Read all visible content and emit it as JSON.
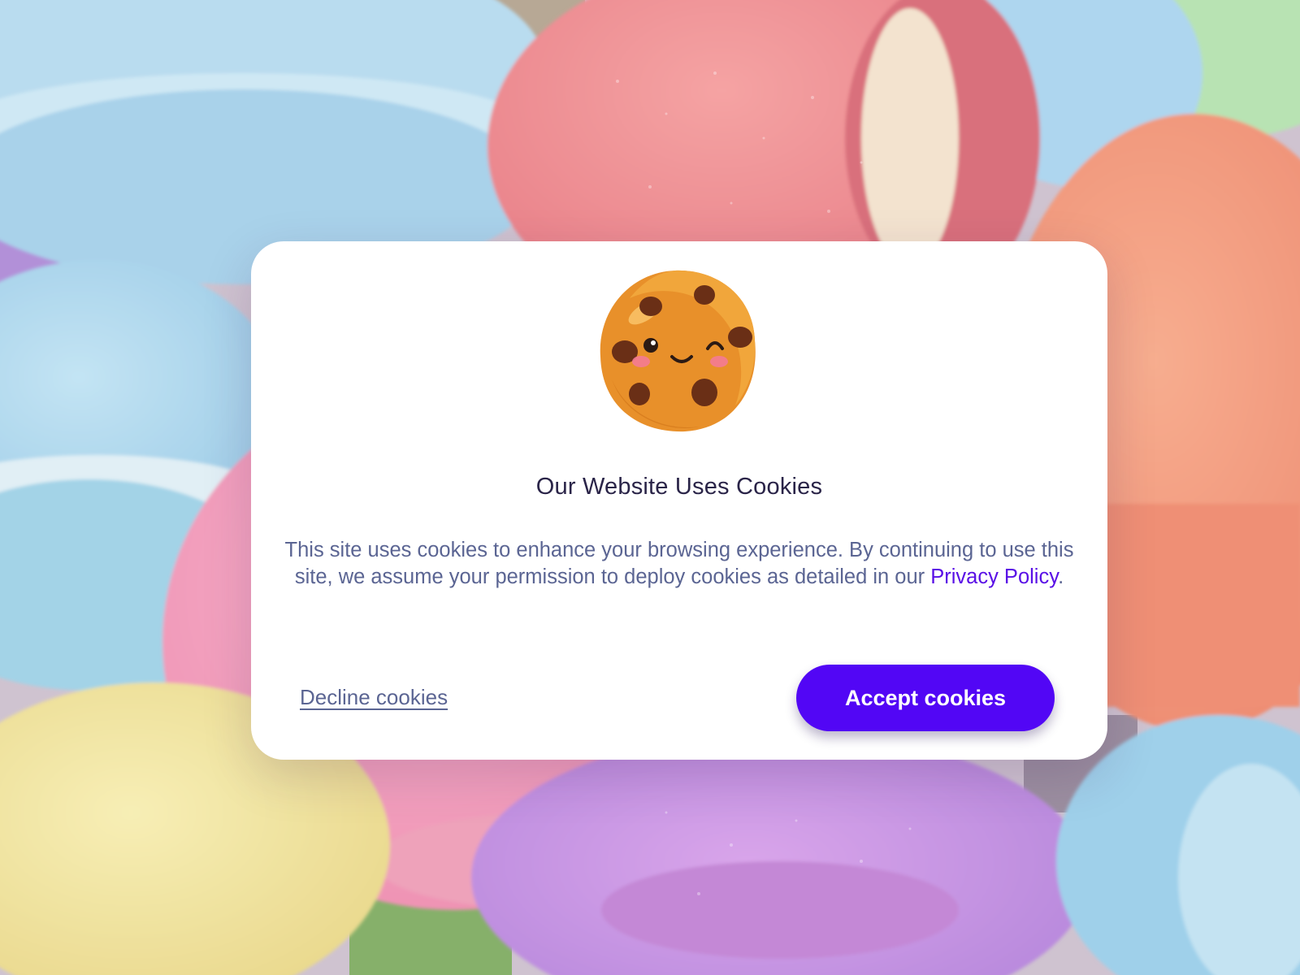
{
  "background": {
    "description_icon": "macarons-photo",
    "colors": [
      "#b6dcef",
      "#f19a9c",
      "#f4b7cf",
      "#c992e6",
      "#ef9b7f",
      "#f2e6a0",
      "#a8d8a8"
    ]
  },
  "cookie_dialog": {
    "icon": "cookie-mascot-icon",
    "title": "Our Website Uses Cookies",
    "body_text": "This site uses cookies to enhance your browsing experience. By continuing to use this site, we assume your permission to deploy cookies as detailed in our ",
    "privacy_link_label": "Privacy Policy",
    "body_end": ".",
    "decline_label": "Decline cookies",
    "accept_label": "Accept cookies",
    "colors": {
      "accent": "#5206f5",
      "title": "#2a2448",
      "body": "#5b6593",
      "link": "#5a10e6"
    }
  }
}
